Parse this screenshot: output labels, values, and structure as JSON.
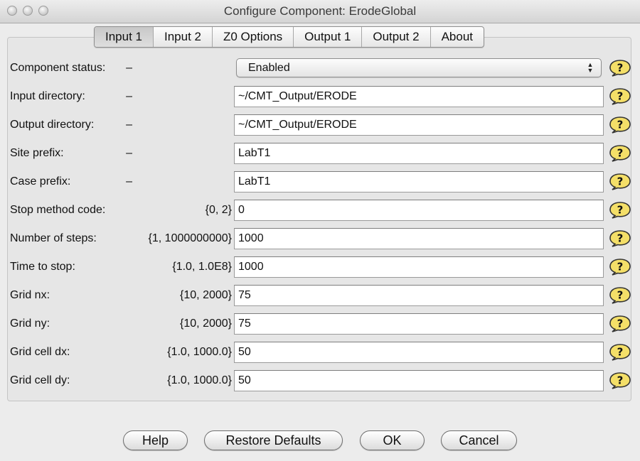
{
  "window": {
    "title": "Configure Component: ErodeGlobal"
  },
  "tabs": [
    {
      "label": "Input 1",
      "active": true
    },
    {
      "label": "Input 2",
      "active": false
    },
    {
      "label": "Z0 Options",
      "active": false
    },
    {
      "label": "Output 1",
      "active": false
    },
    {
      "label": "Output 2",
      "active": false
    },
    {
      "label": "About",
      "active": false
    }
  ],
  "fields": {
    "component_status": {
      "label": "Component status:",
      "range": "–",
      "value": "Enabled",
      "control": "dropdown"
    },
    "input_directory": {
      "label": "Input directory:",
      "range": "–",
      "value": "~/CMT_Output/ERODE"
    },
    "output_directory": {
      "label": "Output directory:",
      "range": "–",
      "value": "~/CMT_Output/ERODE"
    },
    "site_prefix": {
      "label": "Site prefix:",
      "range": "–",
      "value": "LabT1"
    },
    "case_prefix": {
      "label": "Case prefix:",
      "range": "–",
      "value": "LabT1"
    },
    "stop_method_code": {
      "label": "Stop method code:",
      "range": "{0, 2}",
      "value": "0"
    },
    "number_of_steps": {
      "label": "Number of steps:",
      "range": "{1, 1000000000}",
      "value": "1000"
    },
    "time_to_stop": {
      "label": "Time to stop:",
      "range": "{1.0, 1.0E8}",
      "value": "1000"
    },
    "grid_nx": {
      "label": "Grid nx:",
      "range": "{10, 2000}",
      "value": "75"
    },
    "grid_ny": {
      "label": "Grid ny:",
      "range": "{10, 2000}",
      "value": "75"
    },
    "grid_cell_dx": {
      "label": "Grid cell dx:",
      "range": "{1.0, 1000.0}",
      "value": "50"
    },
    "grid_cell_dy": {
      "label": "Grid cell dy:",
      "range": "{1.0, 1000.0}",
      "value": "50"
    }
  },
  "help_icon": "question-speech-bubble-icon",
  "buttons": {
    "help": "Help",
    "restore_defaults": "Restore Defaults",
    "ok": "OK",
    "cancel": "Cancel"
  },
  "colors": {
    "help_icon_fill": "#f4df68",
    "window_bg": "#ececec"
  }
}
